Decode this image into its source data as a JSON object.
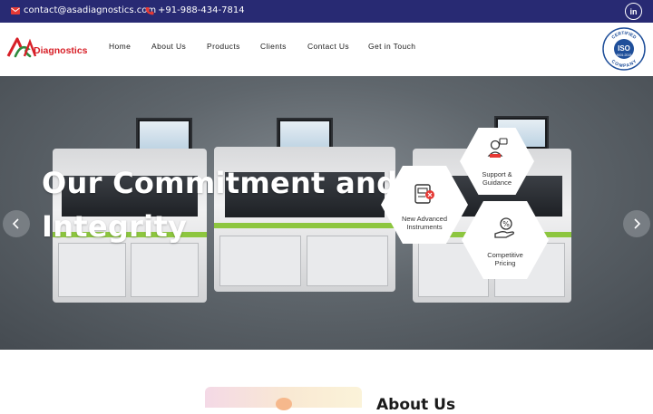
{
  "topbar": {
    "email": "contact@asadiagnostics.com",
    "phone": "+91-988-434-7814",
    "social": "in",
    "colors": {
      "background": "#282a73",
      "icon": "#e53935"
    }
  },
  "header": {
    "logo_text": "Diagnostics",
    "nav": [
      "Home",
      "About Us",
      "Products",
      "Clients",
      "Contact Us",
      "Get in Touch"
    ],
    "badge": {
      "top": "CERTIFIED",
      "mid": "ISO",
      "num": "9001:2015",
      "bottom": "COMPANY"
    }
  },
  "hero": {
    "headline_line1": "Our Commitment and",
    "headline_line2": "Integrity",
    "features": [
      {
        "line1": "Support &",
        "line2": "Guidance",
        "icon": "support-agent-icon"
      },
      {
        "line1": "New Advanced",
        "line2": "Instruments",
        "icon": "instrument-icon"
      },
      {
        "line1": "Competitive",
        "line2": "Pricing",
        "icon": "price-hand-icon"
      }
    ],
    "prev_icon": "chevron-left-icon",
    "next_icon": "chevron-right-icon"
  },
  "about": {
    "title": "About Us"
  }
}
